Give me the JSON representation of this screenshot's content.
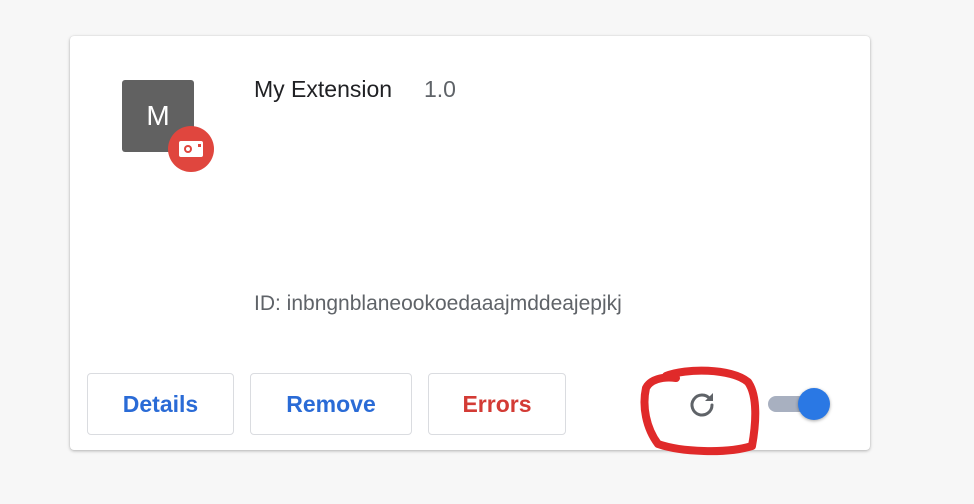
{
  "extension": {
    "icon_letter": "M",
    "name": "My Extension",
    "version": "1.0",
    "id_text": "ID: inbngnblaneookoedaaajmddeajepjkj"
  },
  "buttons": {
    "details": "Details",
    "remove": "Remove",
    "errors": "Errors"
  },
  "toggle": {
    "enabled": true
  },
  "icons": {
    "badge": "camera-badge-icon",
    "reload": "reload-icon"
  },
  "colors": {
    "link_blue": "#2a6bd6",
    "error_red": "#d33b35",
    "badge_red": "#e0463e",
    "toggle_blue": "#2a78e4",
    "annotation_red": "#e02a2a"
  }
}
